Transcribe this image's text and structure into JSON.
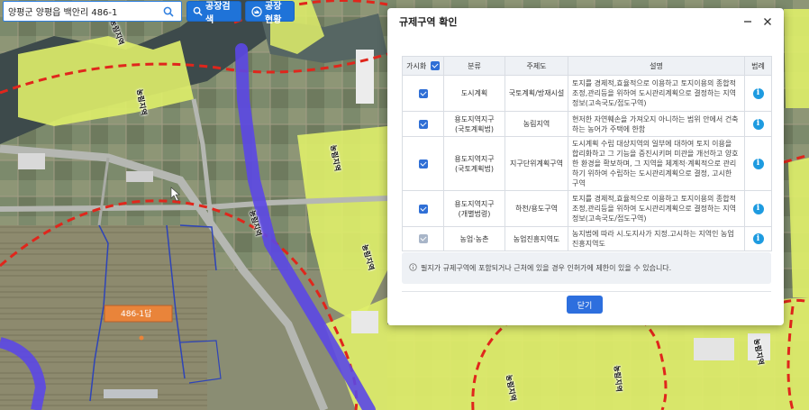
{
  "search": {
    "value": "양평군 양평읍 백안리 486-1",
    "button_search_label": "공장검색",
    "button_status_label": "공장현황"
  },
  "map": {
    "parcel_label": "486-1답",
    "road_labels": [
      "농림지역",
      "농림지역",
      "농림지역",
      "농림지역",
      "농림지역",
      "농림지역",
      "농림지역",
      "농림지역"
    ]
  },
  "modal": {
    "title": "규제구역 확인",
    "columns": [
      "가시화",
      "분류",
      "주제도",
      "설명",
      "범례"
    ],
    "rows": [
      {
        "checked": true,
        "category": "도시계획",
        "theme": "국토계획/방재시설",
        "description": "토지를 경제적,효율적으로 이용하고 토지이용의 종합적 조정,관리등을 위하여 도시관리계획으로 결정하는 지역정보(고속국도/접도구역)"
      },
      {
        "checked": true,
        "category": "용도지역지구\n(국토계획법)",
        "theme": "농림지역",
        "description": "현저한 자연훼손을 가져오지 아니하는 범위 안에서 건축하는 농어가 주택에 한함"
      },
      {
        "checked": true,
        "category": "용도지역지구\n(국토계획법)",
        "theme": "지구단위계획구역",
        "description": "도시계획 수립 대상지역의 일부에 대하여 토지 이용을 합리화하고 그 기능을 증진시키며 미관을 개선하고 양호한 환경을 확보하며, 그 지역을 체계적·계획적으로 관리하기 위하여 수립하는 도시관리계획으로 결정, 고시한 구역"
      },
      {
        "checked": true,
        "category": "용도지역지구\n(개별법령)",
        "theme": "하천/용도구역",
        "description": "토지를 경제적,효율적으로 이용하고 토지이용의 종합적 조정,관리등을 위하여 도시관리계획으로 결정하는 지역정보(고속국도/접도구역)"
      },
      {
        "checked": true,
        "disabled": true,
        "category": "농업·농촌",
        "theme": "농업진흥지역도",
        "description": "농지법에 따라 시.도지사가 지정.고시하는 지역인 농업진흥지역도"
      }
    ],
    "notice": "필지가 규제구역에 포함되거나 근처에 있을 경우 인허가에 제한이 있을 수 있습니다.",
    "close_label": "닫기"
  },
  "colors": {
    "primary": "#1f73d8",
    "zone_yellow": "#dfee6a",
    "route_purple": "#5b47e6",
    "boundary_red": "#e0261c",
    "parcel_orange": "#e9843a"
  }
}
